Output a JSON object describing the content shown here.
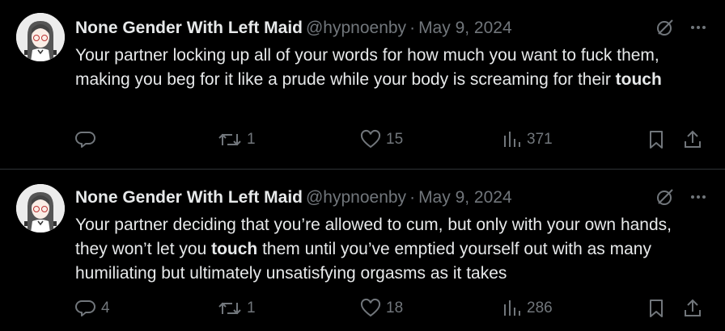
{
  "tweets": [
    {
      "author": "None Gender With Left Maid",
      "handle": "@hypnoenby",
      "separator": "·",
      "date": "May 9, 2024",
      "text_parts": [
        "Your partner locking up all of your words for how much you want to fuck them, making you beg for it like a prude while your body is screaming for their ",
        "touch",
        ""
      ],
      "replies": "",
      "retweets": "1",
      "likes": "15",
      "views": "371"
    },
    {
      "author": "None Gender With Left Maid",
      "handle": "@hypnoenby",
      "separator": "·",
      "date": "May 9, 2024",
      "text_parts": [
        "Your partner deciding that you’re allowed to cum, but only with your own hands, they won’t let you ",
        "touch",
        " them until you’ve emptied yourself out with as many humiliating but ultimately unsatisfying orgasms as it takes"
      ],
      "replies": "4",
      "retweets": "1",
      "likes": "18",
      "views": "286"
    }
  ],
  "colors": {
    "background": "#000000",
    "text": "#e7e9ea",
    "muted": "#71767b",
    "divider": "#2f3336"
  },
  "icons": [
    "grok-icon",
    "more-icon",
    "reply-icon",
    "retweet-icon",
    "like-icon",
    "views-icon",
    "bookmark-icon",
    "share-icon"
  ]
}
